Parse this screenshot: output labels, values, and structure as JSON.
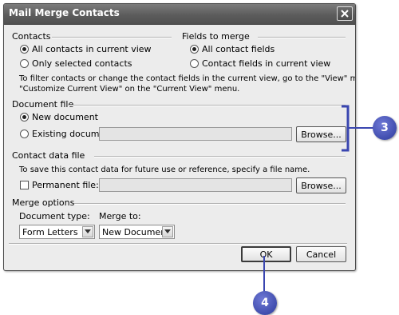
{
  "window": {
    "title": "Mail Merge Contacts"
  },
  "contacts": {
    "heading": "Contacts",
    "options": [
      "All contacts in current view",
      "Only selected contacts"
    ],
    "selected": 0
  },
  "fields": {
    "heading": "Fields to merge",
    "options": [
      "All contact fields",
      "Contact fields in current view"
    ],
    "selected": 0
  },
  "filter_note": {
    "line1": "To filter contacts or change the contact fields in the current view, go to the \"View\" menu and click",
    "line2": "\"Customize Current View\" on the \"Current View\" menu."
  },
  "document_file": {
    "heading": "Document file",
    "new_label": "New document",
    "existing_label": "Existing document:",
    "existing_value": "",
    "browse_label": "Browse...",
    "selected": "new"
  },
  "contact_data_file": {
    "heading": "Contact data file",
    "note": "To save this contact data for future use or reference, specify a file name.",
    "permanent_label": "Permanent file:",
    "permanent_checked": false,
    "file_value": "",
    "browse_label": "Browse..."
  },
  "merge_options": {
    "heading": "Merge options",
    "document_type_label": "Document type:",
    "document_type_value": "Form Letters",
    "merge_to_label": "Merge to:",
    "merge_to_value": "New Document"
  },
  "buttons": {
    "ok": "OK",
    "cancel": "Cancel"
  },
  "callouts": {
    "step3": "3",
    "step4": "4",
    "color": "#3a46b0"
  }
}
